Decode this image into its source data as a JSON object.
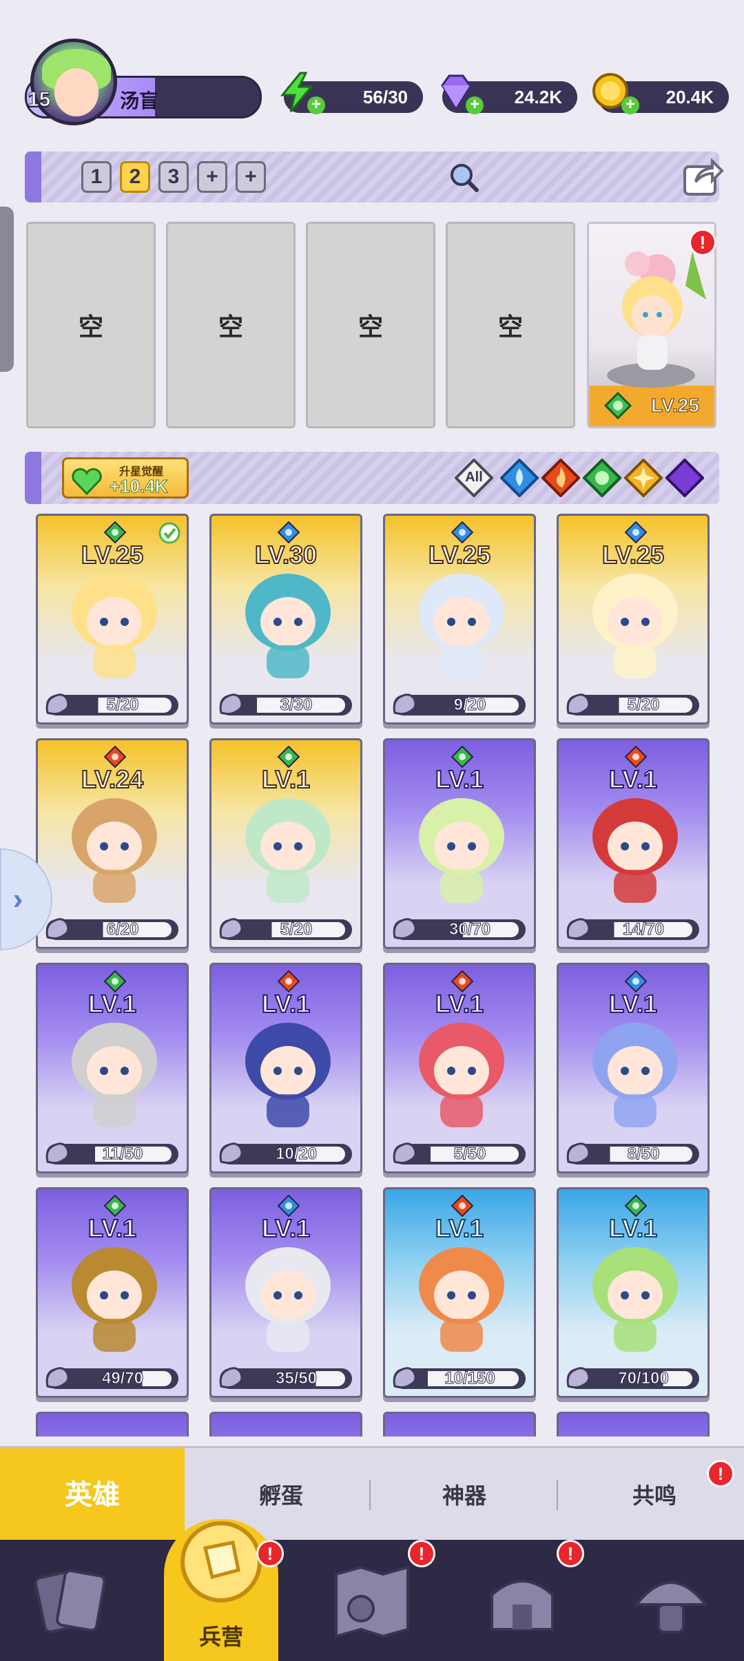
{
  "player": {
    "name": "汤盲",
    "level": "15"
  },
  "resources": {
    "energy": {
      "value": "56/30",
      "icon": "lightning-icon"
    },
    "gems": {
      "value": "24.2K",
      "icon": "diamond-icon"
    },
    "coins": {
      "value": "20.4K",
      "icon": "coin-icon"
    }
  },
  "team_tabs": [
    "1",
    "2",
    "3",
    "+",
    "+"
  ],
  "team_active": "2",
  "slots": [
    "空",
    "空",
    "空",
    "空"
  ],
  "slot_hero": {
    "level": "LV.25"
  },
  "power": {
    "label": "升星觉醒",
    "value": "+10.4K"
  },
  "filters": {
    "all": "All",
    "icons": [
      "water-element-icon",
      "fire-element-icon",
      "wind-element-icon",
      "light-element-icon",
      "dark-element-icon"
    ]
  },
  "heroes": [
    {
      "level": "LV.25",
      "progress": "5/20",
      "frame": "gold",
      "element": "wind",
      "fill": 0.25
    },
    {
      "level": "LV.30",
      "progress": "3/30",
      "frame": "gold",
      "element": "water",
      "fill": 0.1
    },
    {
      "level": "LV.25",
      "progress": "9/20",
      "frame": "gold",
      "element": "water",
      "fill": 0.45
    },
    {
      "level": "LV.25",
      "progress": "5/20",
      "frame": "gold",
      "element": "water",
      "fill": 0.25
    },
    {
      "level": "LV.24",
      "progress": "6/20",
      "frame": "gold",
      "element": "fire",
      "fill": 0.3
    },
    {
      "level": "LV.1",
      "progress": "5/20",
      "frame": "gold",
      "element": "wind",
      "fill": 0.25
    },
    {
      "level": "LV.1",
      "progress": "30/70",
      "frame": "purple",
      "element": "wind",
      "fill": 0.43
    },
    {
      "level": "LV.1",
      "progress": "14/70",
      "frame": "purple",
      "element": "fire",
      "fill": 0.2
    },
    {
      "level": "LV.1",
      "progress": "11/50",
      "frame": "purple",
      "element": "wind",
      "fill": 0.22
    },
    {
      "level": "LV.1",
      "progress": "10/20",
      "frame": "purple",
      "element": "fire",
      "fill": 0.5
    },
    {
      "level": "LV.1",
      "progress": "5/50",
      "frame": "purple",
      "element": "fire",
      "fill": 0.1
    },
    {
      "level": "LV.1",
      "progress": "8/50",
      "frame": "purple",
      "element": "water",
      "fill": 0.16
    },
    {
      "level": "LV.1",
      "progress": "49/70",
      "frame": "purple",
      "element": "wind",
      "fill": 0.7
    },
    {
      "level": "LV.1",
      "progress": "35/50",
      "frame": "purple",
      "element": "water",
      "fill": 0.7
    },
    {
      "level": "LV.1",
      "progress": "10/150",
      "frame": "cyan",
      "element": "fire",
      "fill": 0.07
    },
    {
      "level": "LV.1",
      "progress": "70/100",
      "frame": "cyan",
      "element": "wind",
      "fill": 0.7
    }
  ],
  "subtabs": {
    "active": "英雄",
    "items": [
      "孵蛋",
      "神器",
      "共鸣"
    ]
  },
  "nav": {
    "active_label": "兵营"
  },
  "colors": {
    "accent": "#f6c71c",
    "alert": "#e8262b",
    "panel": "#2e2945"
  }
}
